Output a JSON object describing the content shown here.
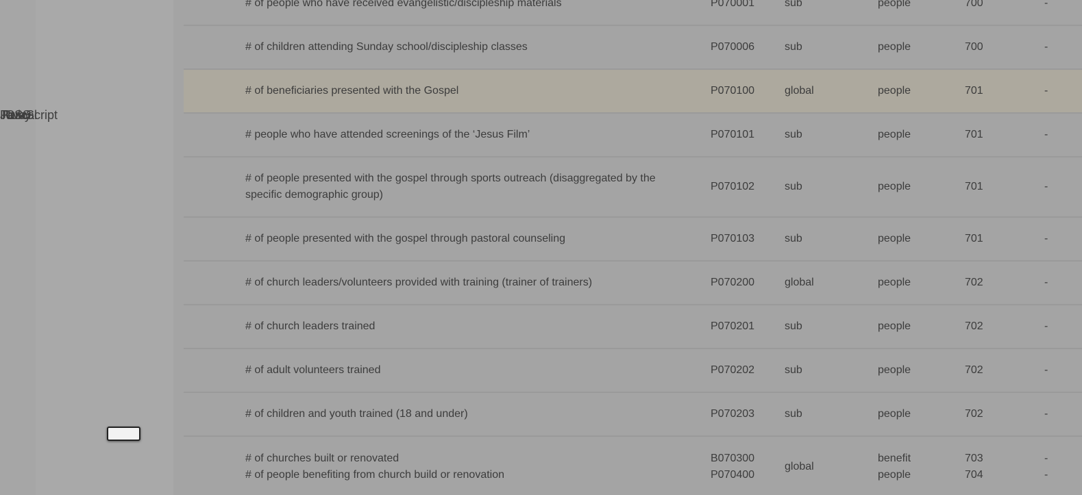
{
  "left_panel": {
    "overlapping_labels": [
      "JavaScript",
      "Pascal",
      "Ruby",
      "CSS"
    ]
  },
  "table": {
    "rows": [
      {
        "desc": [
          "# of people who have received evangelistic/discipleship materials"
        ],
        "code": [
          "P070001"
        ],
        "scope": "sub",
        "unit": [
          "people"
        ],
        "num": [
          "700"
        ],
        "dash": [
          "-"
        ]
      },
      {
        "desc": [
          "# of children attending Sunday school/discipleship classes"
        ],
        "code": [
          "P070006"
        ],
        "scope": "sub",
        "unit": [
          "people"
        ],
        "num": [
          "700"
        ],
        "dash": [
          "-"
        ]
      },
      {
        "desc": [
          "# of beneficiaries presented with the Gospel"
        ],
        "code": [
          "P070100"
        ],
        "scope": "global",
        "unit": [
          "people"
        ],
        "num": [
          "701"
        ],
        "dash": [
          "-"
        ],
        "highlight": true
      },
      {
        "desc": [
          "# people who have attended screenings of the ‘Jesus Film’"
        ],
        "code": [
          "P070101"
        ],
        "scope": "sub",
        "unit": [
          "people"
        ],
        "num": [
          "701"
        ],
        "dash": [
          "-"
        ]
      },
      {
        "desc": [
          "# of people presented with the gospel through sports outreach (disaggregated by the specific demographic group)"
        ],
        "code": [
          "P070102"
        ],
        "scope": "sub",
        "unit": [
          "people"
        ],
        "num": [
          "701"
        ],
        "dash": [
          "-"
        ]
      },
      {
        "desc": [
          "# of people presented with the gospel through pastoral counseling"
        ],
        "code": [
          "P070103"
        ],
        "scope": "sub",
        "unit": [
          "people"
        ],
        "num": [
          "701"
        ],
        "dash": [
          "-"
        ]
      },
      {
        "desc": [
          "# of church leaders/volunteers provided with training (trainer of trainers)"
        ],
        "code": [
          "P070200"
        ],
        "scope": "global",
        "unit": [
          "people"
        ],
        "num": [
          "702"
        ],
        "dash": [
          "-"
        ]
      },
      {
        "desc": [
          "# of church leaders trained"
        ],
        "code": [
          "P070201"
        ],
        "scope": "sub",
        "unit": [
          "people"
        ],
        "num": [
          "702"
        ],
        "dash": [
          "-"
        ]
      },
      {
        "desc": [
          "# of adult volunteers trained"
        ],
        "code": [
          "P070202"
        ],
        "scope": "sub",
        "unit": [
          "people"
        ],
        "num": [
          "702"
        ],
        "dash": [
          "-"
        ]
      },
      {
        "desc": [
          "# of children and youth trained (18 and under)"
        ],
        "code": [
          "P070203"
        ],
        "scope": "sub",
        "unit": [
          "people"
        ],
        "num": [
          "702"
        ],
        "dash": [
          "-"
        ]
      },
      {
        "desc": [
          "# of churches built or renovated",
          "# of people benefiting from church build or renovation"
        ],
        "code": [
          "B070300",
          "P070400"
        ],
        "scope": "global",
        "unit": [
          "benefit",
          "people"
        ],
        "num": [
          "703",
          "704"
        ],
        "dash": [
          "-",
          "-"
        ]
      }
    ]
  }
}
